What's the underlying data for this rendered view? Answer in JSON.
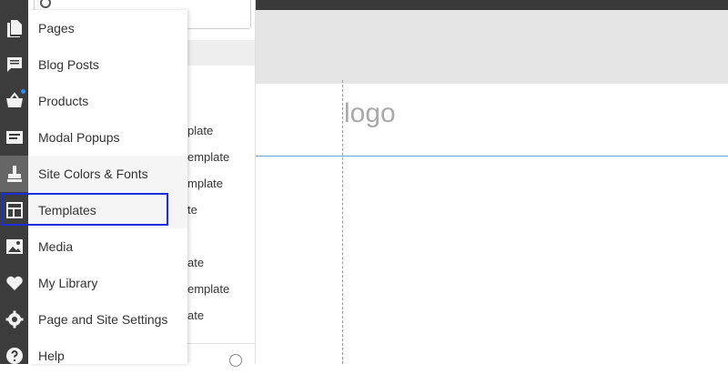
{
  "rail": {
    "icons": [
      "pages-icon",
      "blog-posts-icon",
      "store-icon",
      "modal-popups-icon",
      "brush-icon",
      "templates-icon",
      "media-icon",
      "heart-icon",
      "settings-icon",
      "help-icon"
    ]
  },
  "menu": {
    "items": [
      {
        "label": "Pages"
      },
      {
        "label": "Blog Posts"
      },
      {
        "label": "Products"
      },
      {
        "label": "Modal Popups"
      },
      {
        "label": "Site Colors & Fonts"
      },
      {
        "label": "Templates"
      },
      {
        "label": "Media"
      },
      {
        "label": "My Library"
      },
      {
        "label": "Page and Site Settings"
      },
      {
        "label": "Help"
      }
    ],
    "highlighted": "Templates"
  },
  "templates_panel": {
    "visible_fragments": [
      "plate",
      "emplate",
      "mplate",
      "te",
      "ate",
      "emplate",
      "ate"
    ]
  },
  "canvas": {
    "logo_text": "logo"
  },
  "colors": {
    "rail": "#3c3c3c",
    "highlight_border": "#1a2ee0",
    "notification_dot": "#2d8cf0"
  }
}
